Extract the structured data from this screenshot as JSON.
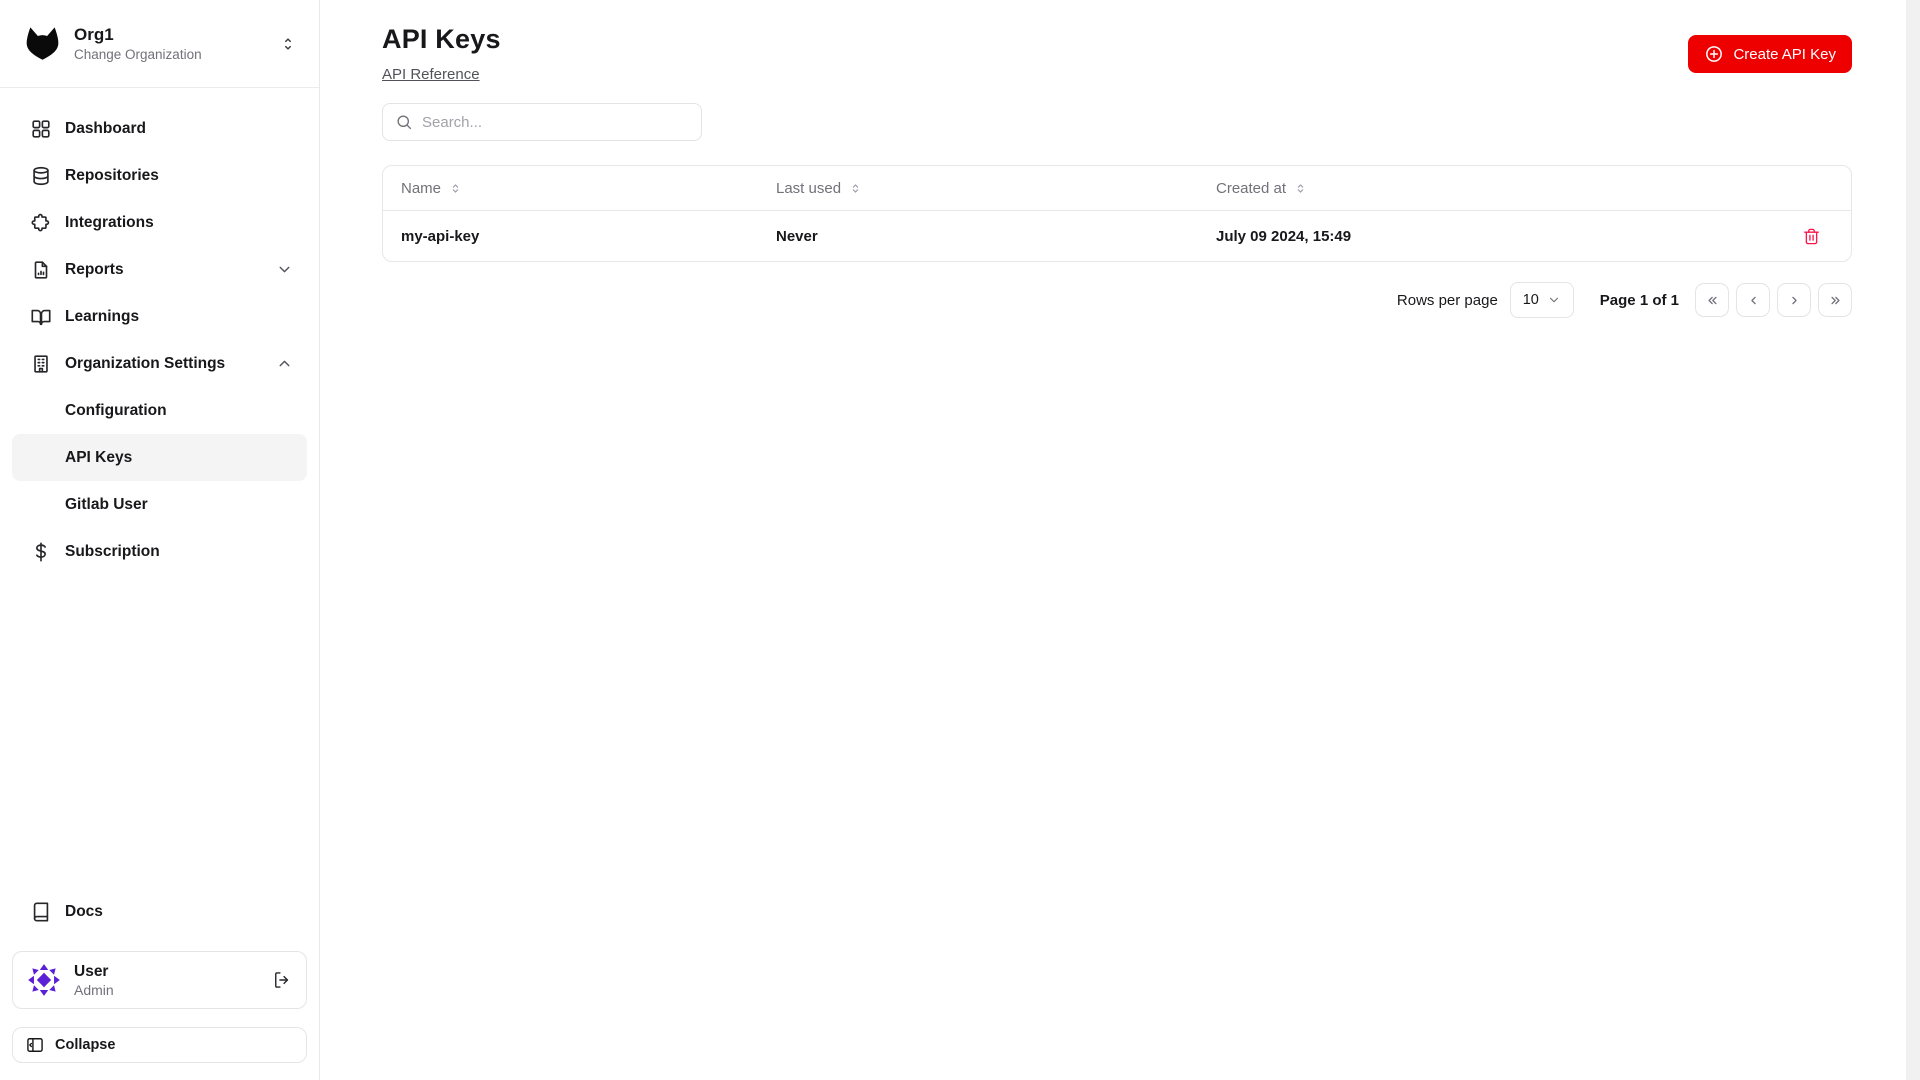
{
  "brand": {
    "org_name": "Org1",
    "org_subtitle": "Change Organization"
  },
  "sidebar": {
    "items": [
      {
        "label": "Dashboard",
        "icon": "grid-icon"
      },
      {
        "label": "Repositories",
        "icon": "database-icon"
      },
      {
        "label": "Integrations",
        "icon": "puzzle-icon"
      },
      {
        "label": "Reports",
        "icon": "file-chart-icon",
        "chevron": "down"
      },
      {
        "label": "Learnings",
        "icon": "book-open-icon"
      },
      {
        "label": "Organization Settings",
        "icon": "building-icon",
        "chevron": "up"
      },
      {
        "label": "Configuration",
        "sub": true
      },
      {
        "label": "API Keys",
        "sub": true,
        "active": true
      },
      {
        "label": "Gitlab User",
        "sub": true
      },
      {
        "label": "Subscription",
        "icon": "dollar-icon"
      }
    ],
    "docs_label": "Docs",
    "user": {
      "name": "User",
      "role": "Admin"
    },
    "collapse_label": "Collapse"
  },
  "main": {
    "title": "API Keys",
    "reference_link": "API Reference",
    "create_button_label": "Create API Key",
    "search": {
      "placeholder": "Search..."
    },
    "table": {
      "columns": [
        "Name",
        "Last used",
        "Created at"
      ],
      "rows": [
        {
          "name": "my-api-key",
          "last_used": "Never",
          "created_at": "July 09 2024, 15:49"
        }
      ]
    },
    "pagination": {
      "rows_per_page_label": "Rows per page",
      "rows_per_page_value": "10",
      "page_info": "Page 1 of 1"
    }
  },
  "colors": {
    "accent_red": "#ef0000",
    "danger_pink": "#fb1549",
    "avatar_purple": "#5b1fd6",
    "active_item_bg": "#f4f4f5"
  }
}
